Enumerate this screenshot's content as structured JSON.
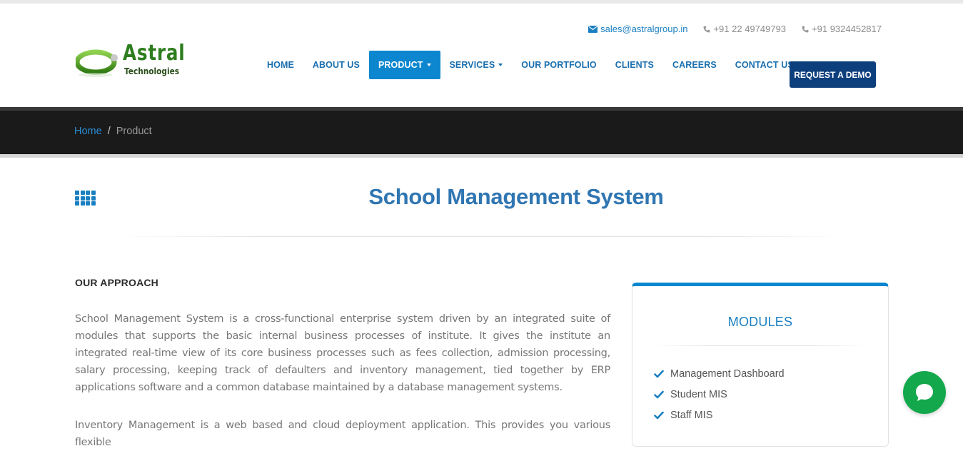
{
  "logo": {
    "name": "Astral",
    "tagline": "Technologies"
  },
  "contacts": {
    "email": "sales@astralgroup.in",
    "phone1": "+91 22 49749793",
    "phone2": "+91 9324452817"
  },
  "nav": {
    "items": [
      {
        "label": "HOME"
      },
      {
        "label": "ABOUT US"
      },
      {
        "label": "PRODUCT"
      },
      {
        "label": "SERVICES"
      },
      {
        "label": "OUR PORTFOLIO"
      },
      {
        "label": "CLIENTS"
      },
      {
        "label": "CAREERS"
      },
      {
        "label": "CONTACT US"
      }
    ],
    "demo_label": "REQUEST A DEMO"
  },
  "breadcrumb": {
    "home": "Home",
    "separator": "/",
    "current": "Product"
  },
  "page": {
    "title": "School Management System",
    "approach_heading": "OUR APPROACH",
    "para1": "School Management System is a cross-functional enterprise system driven by an integrated suite of modules that supports the basic internal business processes of institute. It gives the institute an integrated real-time view of its core business processes such as fees collection, admission processing, salary processing, keeping track of defaulters and inventory management, tied together by ERP applications software and a common database maintained by a database management systems.",
    "para2": "Inventory Management is a web based and cloud deployment application. This provides you various flexible"
  },
  "modules": {
    "title": "MODULES",
    "items": [
      "Management Dashboard",
      "Student MIS",
      "Staff MIS"
    ]
  },
  "colors": {
    "accent": "#0b86cf",
    "nav_text": "#1a6fae",
    "demo_button": "#0e3f7d",
    "breadcrumb_bar": "#1a1a1a",
    "title": "#3076b2",
    "chat": "#13a84c"
  },
  "icons": {
    "email": "envelope-icon",
    "phone": "phone-icon",
    "dropdown": "caret-down-icon",
    "grid": "grid-icon",
    "check": "check-icon",
    "chat": "chat-bubble-icon"
  }
}
